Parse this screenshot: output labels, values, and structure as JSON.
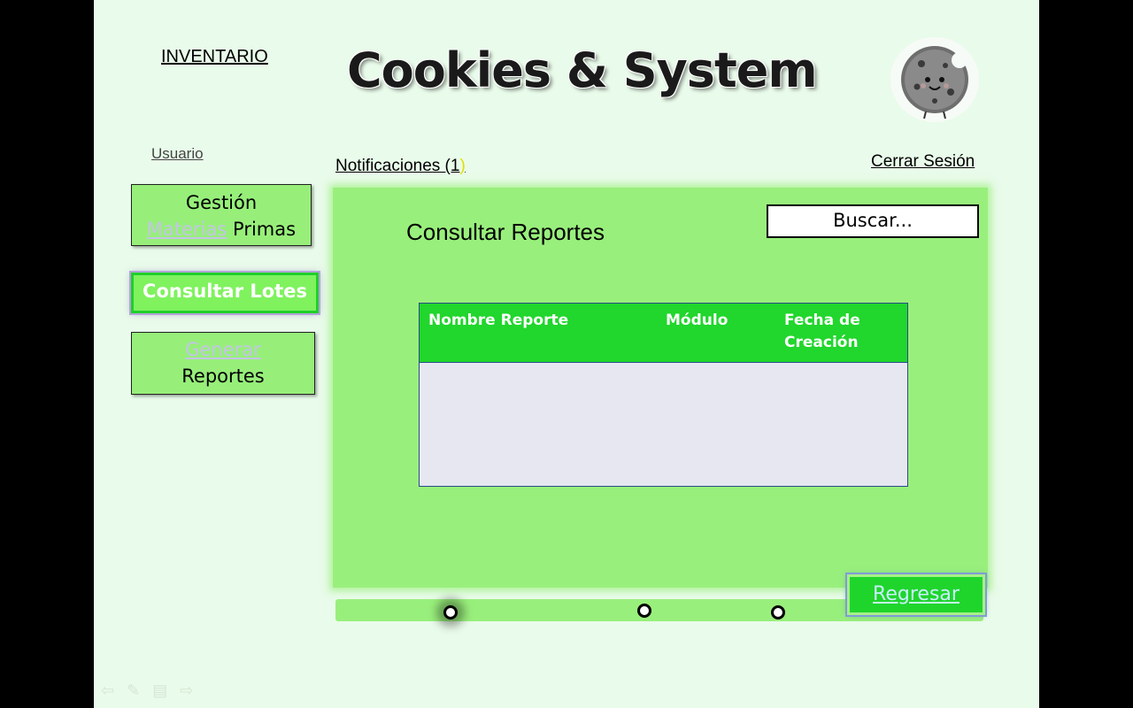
{
  "header": {
    "section_label": "INVENTARIO",
    "app_title": "Cookies & System",
    "logo_icon": "cookie-mascot-icon"
  },
  "user_bar": {
    "user_label": "Usuario",
    "notifications_label": "Notificaciones (1",
    "notifications_close": ")",
    "logout_label": "Cerrar Sesión"
  },
  "sidebar": {
    "items": [
      {
        "line1": "Gestión",
        "line2_faded": "Materias",
        "line2": " Primas"
      },
      {
        "label": "Consultar Lotes"
      },
      {
        "line1_faded": "Generar",
        "line2": "Reportes"
      }
    ]
  },
  "main": {
    "title": "Consultar Reportes",
    "search_placeholder": "Buscar...",
    "table": {
      "columns": [
        "Nombre Reporte",
        "Módulo",
        "Fecha de Creación"
      ],
      "rows": []
    },
    "back_button": "Regresar"
  },
  "progress": {
    "steps": 3,
    "current_step": 1
  },
  "slideshow_controls": [
    "prev-arrow-icon",
    "pen-icon",
    "menu-icon",
    "next-arrow-icon"
  ],
  "colors": {
    "background": "#e9fbea",
    "panel": "#99ef7c",
    "accent_green": "#21d62c",
    "table_body": "#e7e7f1"
  }
}
